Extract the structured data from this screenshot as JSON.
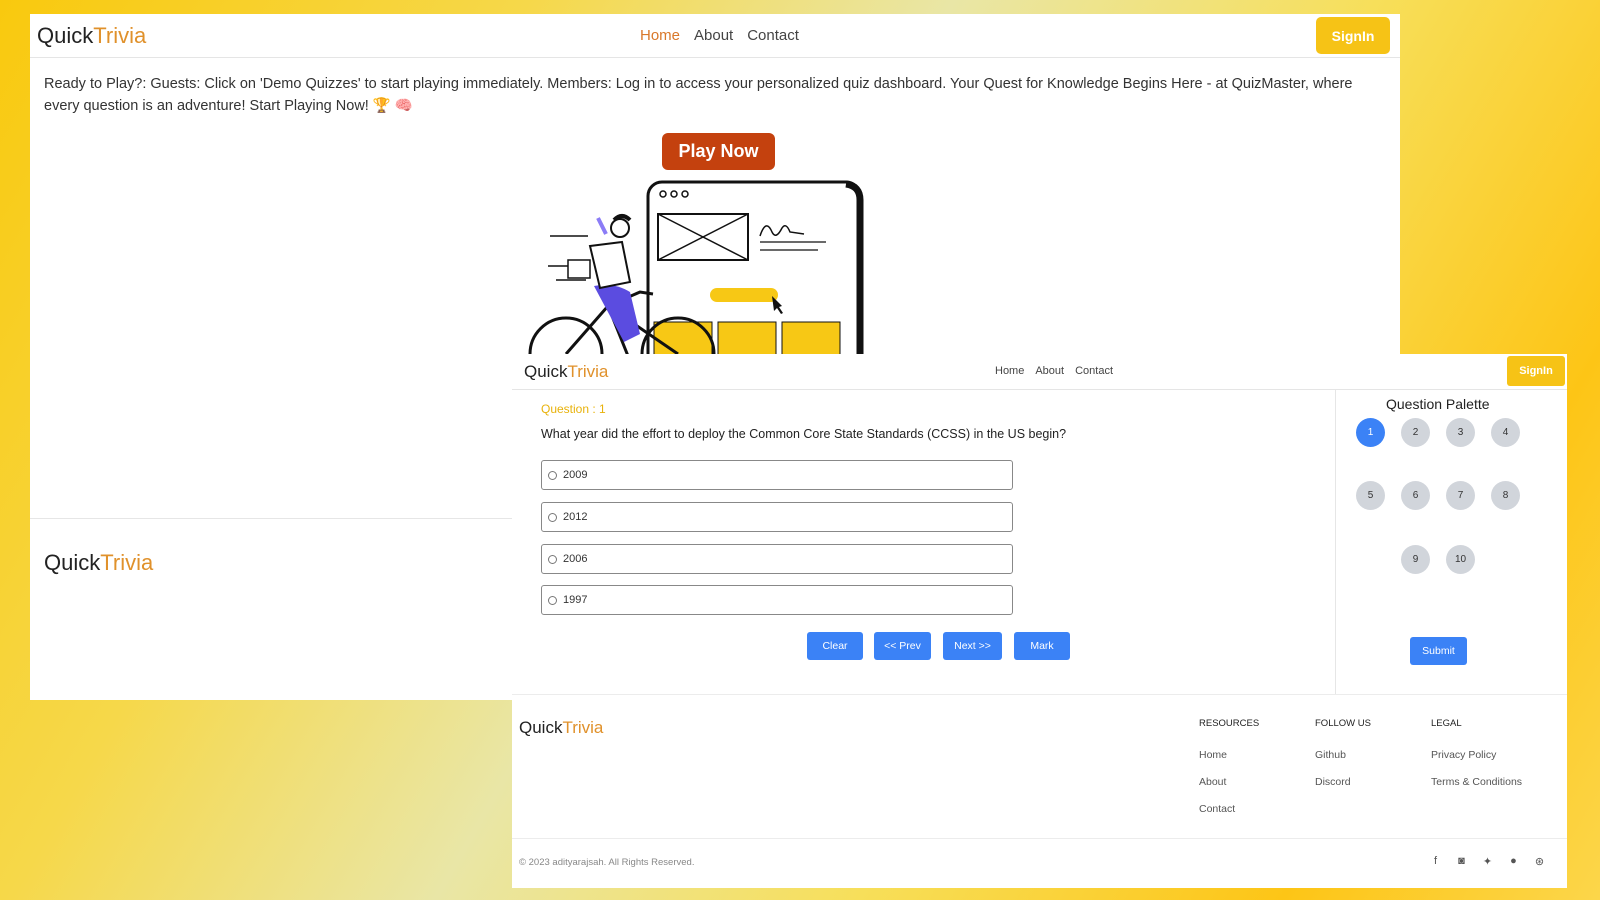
{
  "brand": {
    "part1": "Quick",
    "part2": "Trivia"
  },
  "landing": {
    "nav": {
      "home": "Home",
      "about": "About",
      "contact": "Contact",
      "signin": "SignIn"
    },
    "intro": "Ready to Play?: Guests: Click on 'Demo Quizzes' to start playing immediately. Members: Log in to access your personalized quiz dashboard. Your Quest for Knowledge Begins Here - at QuizMaster, where every question is an adventure! Start Playing Now! 🏆 🧠",
    "play_button": "Play Now"
  },
  "quiz": {
    "nav": {
      "home": "Home",
      "about": "About",
      "contact": "Contact",
      "signin": "SignIn"
    },
    "question_label": "Question : 1",
    "question_text": "What year did the effort to deploy the Common Core State Standards (CCSS) in the US begin?",
    "options": [
      "2009",
      "2012",
      "2006",
      "1997"
    ],
    "buttons": {
      "clear": "Clear",
      "prev": "<< Prev",
      "next": "Next >>",
      "mark": "Mark"
    },
    "palette": {
      "title": "Question Palette",
      "numbers": [
        "1",
        "2",
        "3",
        "4",
        "5",
        "6",
        "7",
        "8",
        "9",
        "10"
      ],
      "current": 1,
      "submit": "Submit"
    },
    "footer": {
      "resources": {
        "title": "RESOURCES",
        "items": [
          "Home",
          "About",
          "Contact"
        ]
      },
      "follow": {
        "title": "FOLLOW US",
        "items": [
          "Github",
          "Discord"
        ]
      },
      "legal": {
        "title": "LEGAL",
        "items": [
          "Privacy Policy",
          "Terms & Conditions"
        ]
      },
      "copyright": "© 2023 adityarajsah. All Rights Reserved.",
      "social_icons": [
        "facebook-icon",
        "discord-icon",
        "twitter-icon",
        "github-icon",
        "dribbble-icon"
      ]
    }
  },
  "colors": {
    "accent": "#e0912b",
    "yellow": "#f6c316",
    "play": "#c4410e",
    "blue": "#3b82f6"
  }
}
